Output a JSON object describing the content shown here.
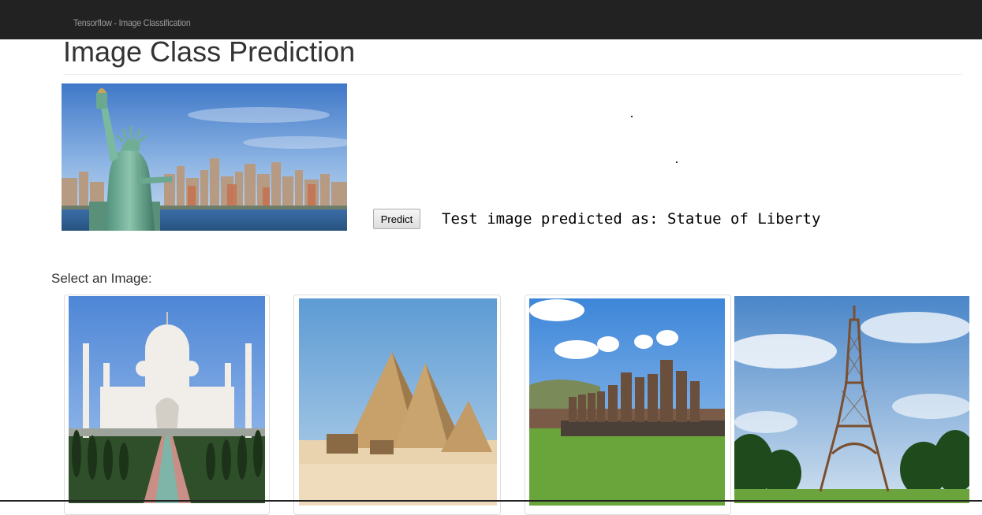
{
  "navbar": {
    "brand": "Tensorflow - Image Classification"
  },
  "page": {
    "title": "Image Class Prediction"
  },
  "test_image": {
    "subject": "statue-of-liberty-skyline"
  },
  "predict_button": {
    "label": "Predict"
  },
  "result": {
    "text": "Test image predicted as: Statue of Liberty"
  },
  "gallery": {
    "label": "Select an Image:",
    "items": [
      {
        "subject": "taj-mahal"
      },
      {
        "subject": "pyramids-of-giza"
      },
      {
        "subject": "moai-easter-island"
      },
      {
        "subject": "eiffel-tower"
      }
    ]
  },
  "colors": {
    "navbar": "#222222",
    "brand_text": "#9d9d9d",
    "title_text": "#333333"
  }
}
